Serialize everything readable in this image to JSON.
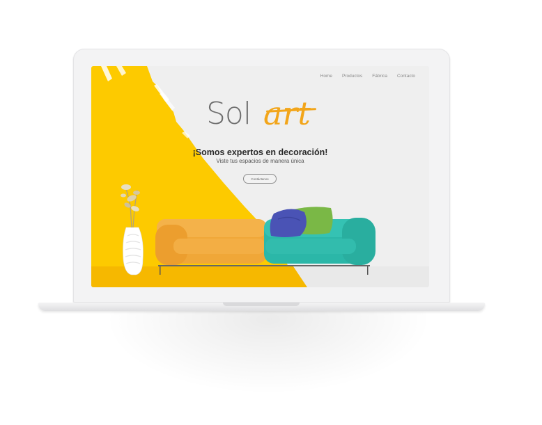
{
  "nav": {
    "items": [
      {
        "label": "Home"
      },
      {
        "label": "Productos"
      },
      {
        "label": "Fábrica"
      },
      {
        "label": "Contacto"
      }
    ]
  },
  "brand": {
    "logo_part1": "Sol",
    "logo_part2": "art",
    "accent_color": "#f2a51a",
    "yellow_color": "#fdca00"
  },
  "hero": {
    "headline": "¡Somos expertos en decoración!",
    "subheadline": "Viste tus espacios de manera única",
    "cta_label": "Contáctanos"
  }
}
